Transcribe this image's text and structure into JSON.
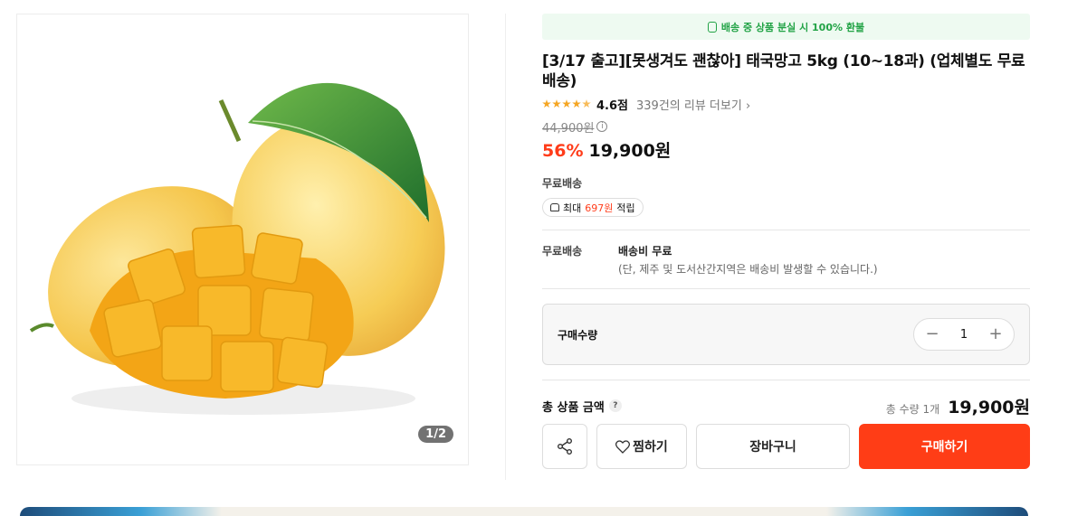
{
  "gallery": {
    "pager": "1/2",
    "image_alt": "mango"
  },
  "product": {
    "banner": "배송 중 상품 분실 시 100% 환불",
    "title": "[3/17 출고][못생겨도 괜찮아] 태국망고 5kg (10~18과) (업체별도 무료배송)",
    "rating": {
      "stars": 4.6,
      "score": "4.6점",
      "reviews": "339건의 리뷰 더보기"
    },
    "original_price": "44,900원",
    "discount": "56%",
    "price": "19,900원",
    "shipping_free": "무료배송",
    "points": {
      "prefix": "최대",
      "amount": "697원",
      "suffix": "적립"
    }
  },
  "delivery": {
    "label": "무료배송",
    "value": "배송비 무료",
    "note": "(단, 제주 및 도서산간지역은 배송비 발생할 수 있습니다.)"
  },
  "quantity": {
    "label": "구매수량",
    "value": "1",
    "minus": "−",
    "plus": "+"
  },
  "total": {
    "label": "총 상품 금액",
    "help": "?",
    "count": "총 수량 1개",
    "amount": "19,900원"
  },
  "actions": {
    "wish": "찜하기",
    "cart": "장바구니",
    "buy": "구매하기"
  },
  "colors": {
    "accent": "#ff3d16",
    "green": "#22a346",
    "star": "#f5a623"
  },
  "icons": [
    "coin-icon",
    "star-icon",
    "info-icon",
    "point-icon",
    "share-icon",
    "heart-icon",
    "chevron-right-icon"
  ]
}
